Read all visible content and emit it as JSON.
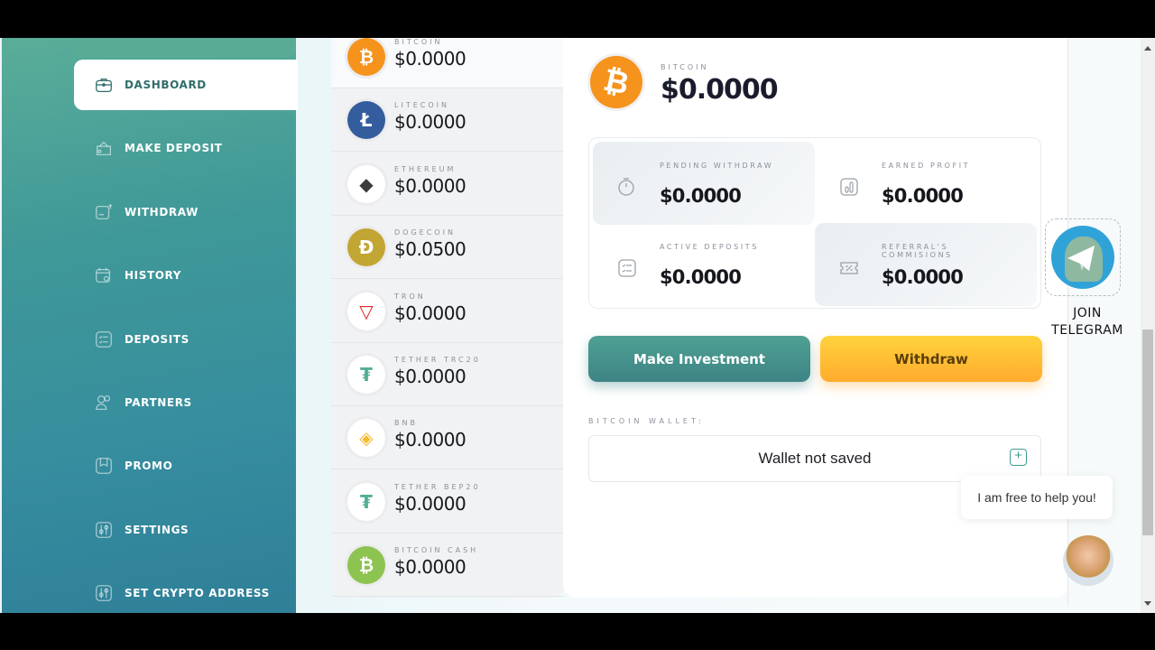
{
  "sidebar": {
    "items": [
      {
        "label": "DASHBOARD",
        "icon": "briefcase-icon",
        "active": true
      },
      {
        "label": "MAKE DEPOSIT",
        "icon": "wallet-icon"
      },
      {
        "label": "WITHDRAW",
        "icon": "card-upload-icon"
      },
      {
        "label": "HISTORY",
        "icon": "calendar-search-icon"
      },
      {
        "label": "DEPOSITS",
        "icon": "checklist-icon"
      },
      {
        "label": "PARTNERS",
        "icon": "users-icon"
      },
      {
        "label": "PROMO",
        "icon": "bookmark-icon"
      },
      {
        "label": "SETTINGS",
        "icon": "sliders-icon"
      },
      {
        "label": "SET CRYPTO ADDRESS",
        "icon": "sliders-icon"
      }
    ]
  },
  "coins": [
    {
      "name": "BITCOIN",
      "value": "$0.0000",
      "color": "#f5931c",
      "glyph": "₿"
    },
    {
      "name": "LITECOIN",
      "value": "$0.0000",
      "color": "#345d9d",
      "glyph": "Ł"
    },
    {
      "name": "ETHEREUM",
      "value": "$0.0000",
      "color": "#3c3c3d",
      "glyph": "◆"
    },
    {
      "name": "DOGECOIN",
      "value": "$0.0500",
      "color": "#c2a633",
      "glyph": "Ð"
    },
    {
      "name": "TRON",
      "value": "$0.0000",
      "color": "#e0262a",
      "glyph": "▽"
    },
    {
      "name": "TETHER TRC20",
      "value": "$0.0000",
      "color": "#50af95",
      "glyph": "₮"
    },
    {
      "name": "BNB",
      "value": "$0.0000",
      "color": "#f3ba2f",
      "glyph": "◈"
    },
    {
      "name": "TETHER BEP20",
      "value": "$0.0000",
      "color": "#50af95",
      "glyph": "₮"
    },
    {
      "name": "BITCOIN CASH",
      "value": "$0.0000",
      "color": "#8dc351",
      "glyph": "₿"
    }
  ],
  "selected": {
    "name": "BITCOIN",
    "value": "$0.0000",
    "glyph": "₿"
  },
  "stats": [
    {
      "label": "PENDING WITHDRAW",
      "value": "$0.0000",
      "icon": "timer-icon"
    },
    {
      "label": "EARNED PROFIT",
      "value": "$0.0000",
      "icon": "bar-chart-icon"
    },
    {
      "label": "ACTIVE DEPOSITS",
      "value": "$0.0000",
      "icon": "checklist-icon"
    },
    {
      "label": "REFERRAL'S COMMISIONS",
      "value": "$0.0000",
      "icon": "percent-ticket-icon"
    }
  ],
  "buttons": {
    "invest": "Make Investment",
    "withdraw": "Withdraw"
  },
  "wallet": {
    "label": "BITCOIN WALLET:",
    "status": "Wallet not saved",
    "add": "+"
  },
  "telegram": {
    "line1": "JOIN",
    "line2": "TELEGRAM"
  },
  "chat": {
    "message": "I am free to help you!"
  },
  "colors": {
    "accent": "#3f9b91",
    "warning": "#ffb52e",
    "sidebar": "#3a8f9c"
  }
}
